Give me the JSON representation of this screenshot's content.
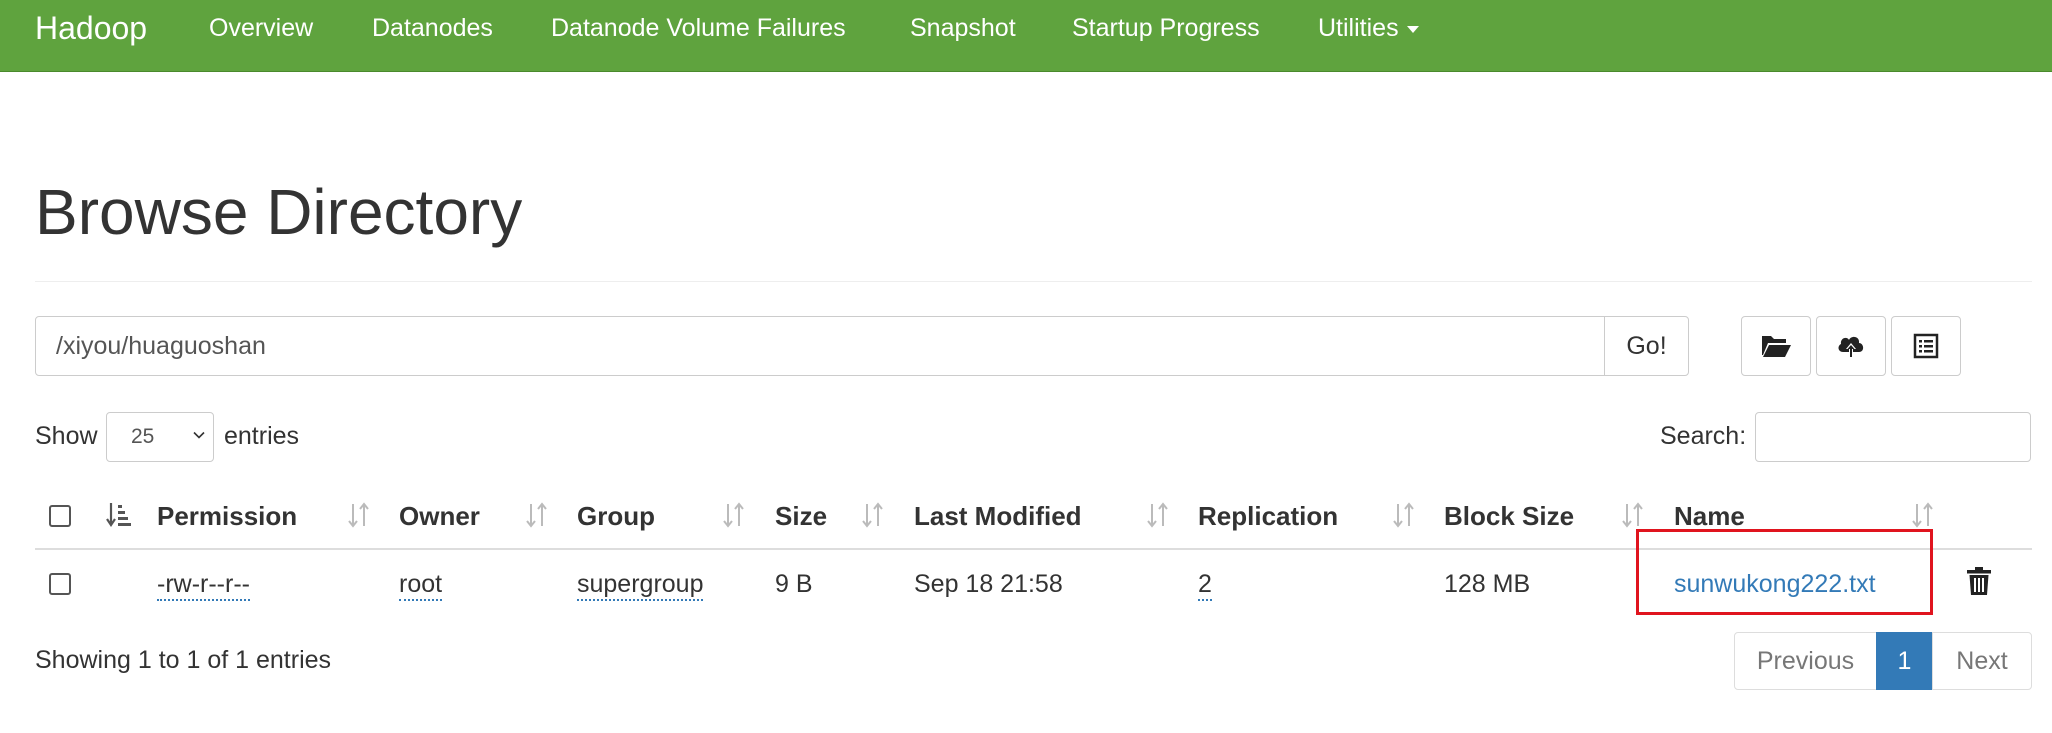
{
  "navbar": {
    "brand": "Hadoop",
    "items": [
      {
        "label": "Overview"
      },
      {
        "label": "Datanodes"
      },
      {
        "label": "Datanode Volume Failures"
      },
      {
        "label": "Snapshot"
      },
      {
        "label": "Startup Progress"
      },
      {
        "label": "Utilities"
      }
    ],
    "background_color": "#5fa33e"
  },
  "page": {
    "title": "Browse Directory"
  },
  "path_bar": {
    "value": "/xiyou/huaguoshan",
    "go_label": "Go!",
    "tools": [
      "folder-open-icon",
      "cloud-upload-icon",
      "list-icon"
    ]
  },
  "controls": {
    "show_label": "Show",
    "entries_value": "25",
    "entries_label": "entries",
    "search_label": "Search:",
    "search_value": ""
  },
  "table": {
    "columns": [
      "Permission",
      "Owner",
      "Group",
      "Size",
      "Last Modified",
      "Replication",
      "Block Size",
      "Name"
    ],
    "rows": [
      {
        "permission": "-rw-r--r--",
        "owner": "root",
        "group": "supergroup",
        "size": "9 B",
        "last_modified": "Sep 18 21:58",
        "replication": "2",
        "block_size": "128 MB",
        "name": "sunwukong222.txt"
      }
    ]
  },
  "footer": {
    "info": "Showing 1 to 1 of 1 entries",
    "pagination": {
      "previous": "Previous",
      "current": "1",
      "next": "Next"
    }
  },
  "colors": {
    "link": "#337ab7",
    "highlight_box": "#e0141e"
  }
}
